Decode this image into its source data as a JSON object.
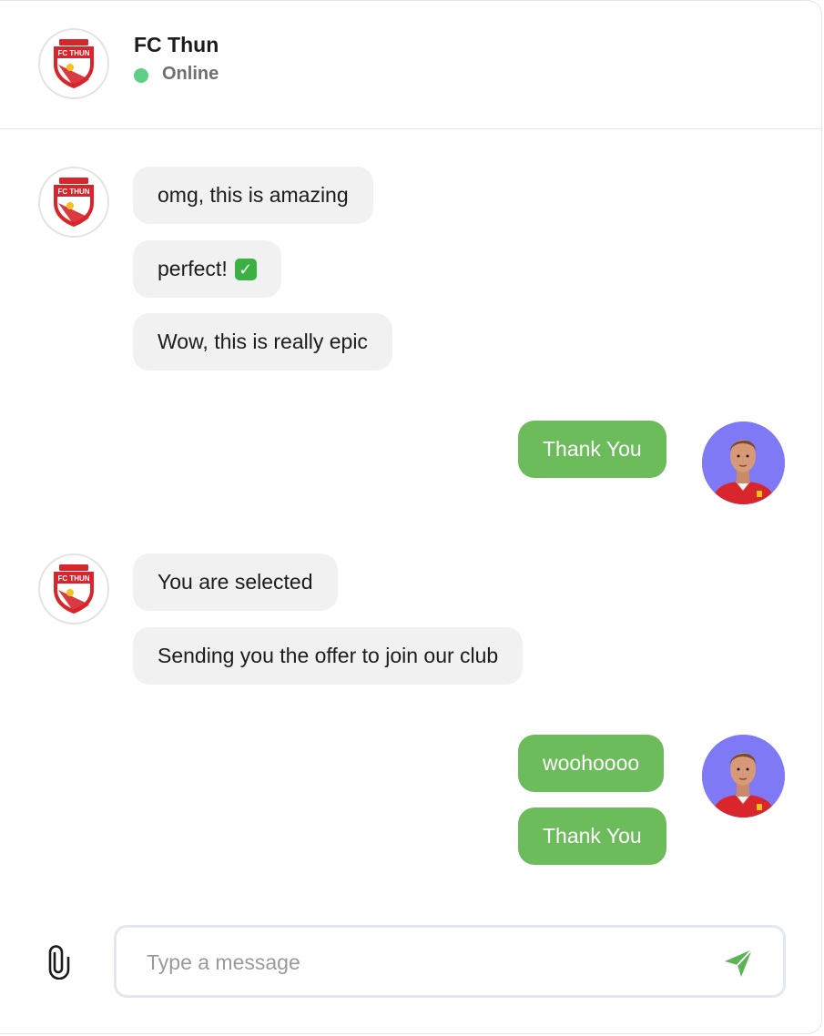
{
  "header": {
    "title": "FC Thun",
    "status": "Online",
    "status_color": "#5fcf86"
  },
  "colors": {
    "incoming_bubble": "#f1f1f1",
    "outgoing_bubble": "#6cbc5c",
    "player_avatar_bg": "#8079f6",
    "club_red": "#d7262b"
  },
  "messages": [
    {
      "from": "club",
      "text": "omg, this is amazing"
    },
    {
      "from": "club",
      "text": "perfect!",
      "emoji": "check-mark-button"
    },
    {
      "from": "club",
      "text": "Wow, this is really epic"
    },
    {
      "from": "player",
      "text": "Thank You"
    },
    {
      "from": "club",
      "text": "You are selected"
    },
    {
      "from": "club",
      "text": "Sending you the offer to join our club"
    },
    {
      "from": "player",
      "text": "woohoooo"
    },
    {
      "from": "player",
      "text": "Thank You"
    }
  ],
  "composer": {
    "placeholder": "Type a message",
    "attach_icon": "paperclip-icon",
    "send_icon": "send-icon"
  }
}
